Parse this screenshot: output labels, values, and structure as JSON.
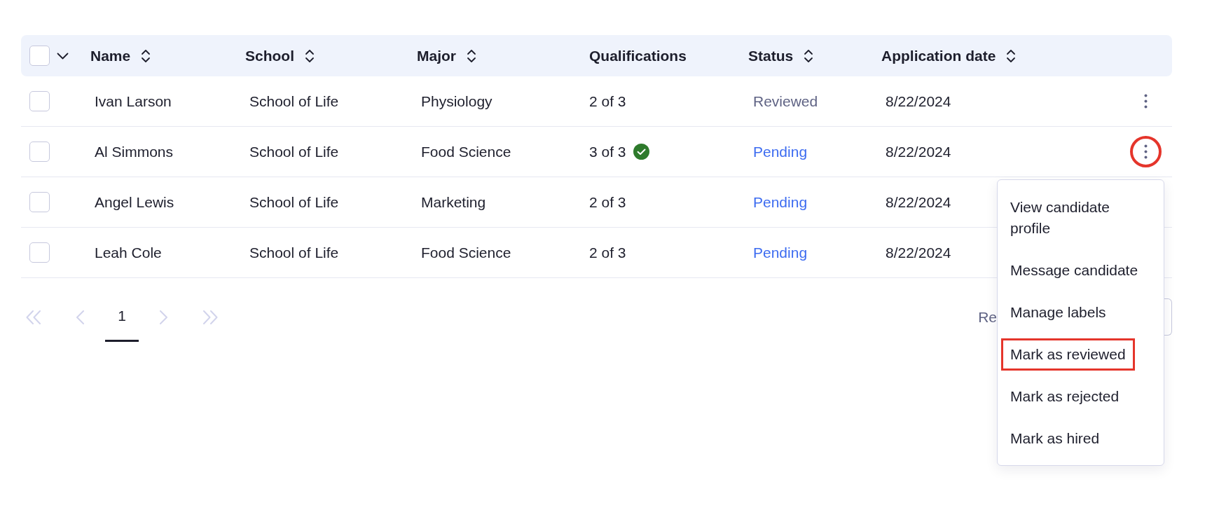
{
  "table": {
    "select_all": {
      "checked": false
    },
    "columns": [
      {
        "label": "Name",
        "sortable": true
      },
      {
        "label": "School",
        "sortable": true
      },
      {
        "label": "Major",
        "sortable": true
      },
      {
        "label": "Qualifications",
        "sortable": false
      },
      {
        "label": "Status",
        "sortable": true
      },
      {
        "label": "Application date",
        "sortable": true
      }
    ],
    "rows": [
      {
        "checked": false,
        "name": "Ivan Larson",
        "school": "School of Life",
        "major": "Physiology",
        "qualifications": {
          "text": "2 of 3",
          "complete": false
        },
        "status": {
          "label": "Reviewed",
          "color": "#5f6384"
        },
        "application_date": "8/22/2024",
        "menu_button": {
          "highlighted": false
        }
      },
      {
        "checked": false,
        "name": "Al Simmons",
        "school": "School of Life",
        "major": "Food Science",
        "qualifications": {
          "text": "3 of 3",
          "complete": true
        },
        "status": {
          "label": "Pending",
          "color": "#3d6cf0"
        },
        "application_date": "8/22/2024",
        "menu_button": {
          "highlighted": true,
          "menu": {
            "items": [
              {
                "label": "View candidate profile",
                "highlighted": false
              },
              {
                "label": "Message candidate",
                "highlighted": false
              },
              {
                "label": "Manage labels",
                "highlighted": false
              },
              {
                "label": "Mark as reviewed",
                "highlighted": true
              },
              {
                "label": "Mark as rejected",
                "highlighted": false
              },
              {
                "label": "Mark as hired",
                "highlighted": false
              }
            ]
          }
        }
      },
      {
        "checked": false,
        "name": "Angel Lewis",
        "school": "School of Life",
        "major": "Marketing",
        "qualifications": {
          "text": "2 of 3",
          "complete": false
        },
        "status": {
          "label": "Pending",
          "color": "#3d6cf0"
        },
        "application_date": "8/22/2024"
      },
      {
        "checked": false,
        "name": "Leah Cole",
        "school": "School of Life",
        "major": "Food Science",
        "qualifications": {
          "text": "2 of 3",
          "complete": false
        },
        "status": {
          "label": "Pending",
          "color": "#3d6cf0"
        },
        "application_date": "8/22/2024"
      }
    ]
  },
  "footer": {
    "pagination": {
      "first": {
        "disabled": true
      },
      "previous": {
        "disabled": true
      },
      "pages": [
        {
          "label": "1",
          "selected": true
        }
      ],
      "next": {
        "disabled": true
      },
      "last": {
        "disabled": true
      }
    },
    "rows_label": "Re"
  }
}
